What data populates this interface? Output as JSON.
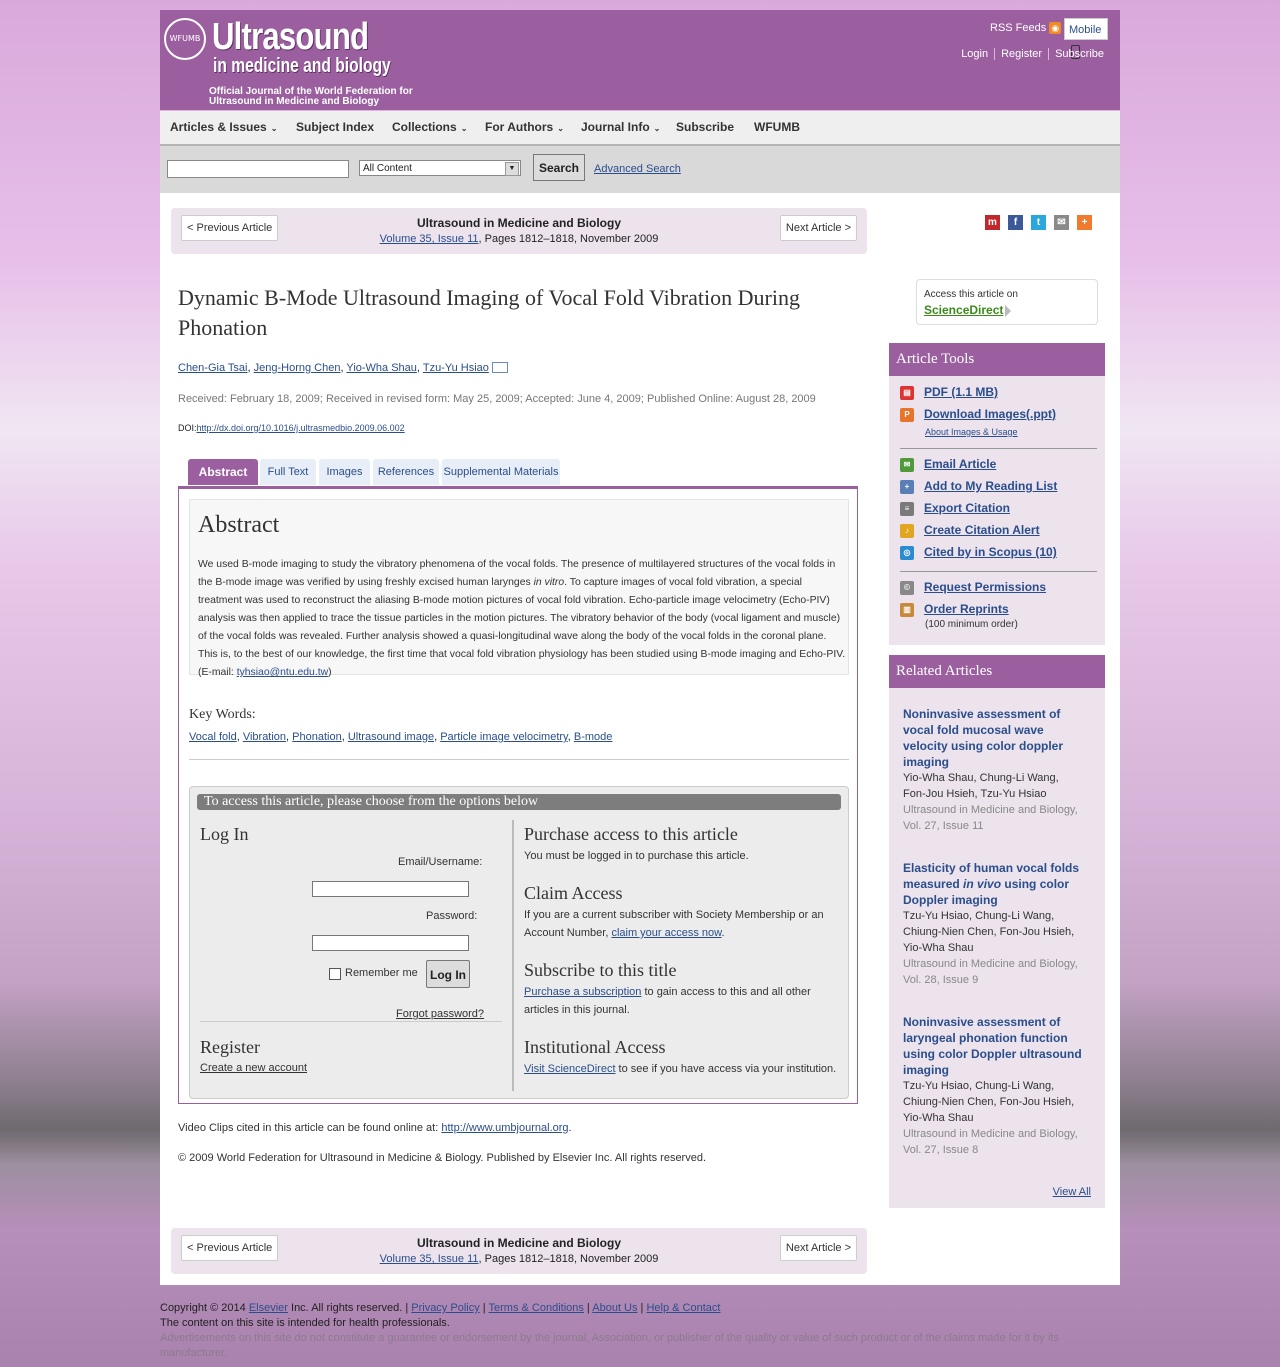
{
  "header": {
    "logo_seal": "WFUMB",
    "logo_title": "Ultrasound",
    "logo_subtitle": "in medicine and biology",
    "logo_desc": "Official Journal of the World Federation for Ultrasound in Medicine and Biology",
    "rss": "RSS Feeds",
    "mobile": "Mobile",
    "login": "Login",
    "register": "Register",
    "subscribe": "Subscribe"
  },
  "nav": {
    "items": [
      "Articles & Issues",
      "Subject Index",
      "Collections",
      "For Authors",
      "Journal Info",
      "Subscribe",
      "WFUMB"
    ]
  },
  "search": {
    "select_value": "All Content",
    "button": "Search",
    "advanced": "Advanced Search"
  },
  "article_nav": {
    "prev": "< Previous Article",
    "next": "Next Article >",
    "journal": "Ultrasound in Medicine and Biology",
    "volume_link": "Volume 35, Issue 11",
    "pages": ", Pages 1812–1818, November 2009"
  },
  "article": {
    "title": "Dynamic B-Mode Ultrasound Imaging of Vocal Fold Vibration During Phonation",
    "authors": [
      "Chen-Gia Tsai",
      "Jeng-Horng Chen",
      "Yio-Wha Shau",
      "Tzu-Yu Hsiao"
    ],
    "dates": "Received: February 18, 2009; Received in revised form: May 25, 2009; Accepted: June 4, 2009; Published Online: August 28, 2009",
    "doi_label": "DOI:",
    "doi": "http://dx.doi.org/10.1016/j.ultrasmedbio.2009.06.002"
  },
  "tabs": [
    "Abstract",
    "Full Text",
    "Images",
    "References",
    "Supplemental Materials"
  ],
  "abstract": {
    "heading": "Abstract",
    "text_1": "We used B-mode imaging to study the vibratory phenomena of the vocal folds. The presence of multilayered structures of the vocal folds in the B-mode image was verified by using freshly excised human larynges ",
    "text_italic": "in vitro",
    "text_2": ". To capture images of vocal fold vibration, a special treatment was used to reconstruct the aliasing B-mode motion pictures of vocal fold vibration. Echo-particle image velocimetry (Echo-PIV) analysis was then applied to trace the tissue particles in the motion pictures. The vibratory behavior of the body (vocal ligament and muscle) of the vocal folds was revealed. Further analysis showed a quasi-longitudinal wave along the body of the vocal folds in the coronal plane. This is, to the best of our knowledge, the first time that vocal fold vibration physiology has been studied using B-mode imaging and Echo-PIV. (E-mail: ",
    "email": "tyhsiao@ntu.edu.tw",
    "text_3": ")"
  },
  "keywords": {
    "heading": "Key Words:",
    "items": [
      "Vocal fold",
      "Vibration",
      "Phonation",
      "Ultrasound image",
      "Particle image velocimetry",
      "B-mode"
    ]
  },
  "access": {
    "bar": "To access this article, please choose from the options below",
    "login_heading": "Log In",
    "email_label": "Email/Username:",
    "password_label": "Password:",
    "remember": "Remember me",
    "login_button": "Log In",
    "forgot": "Forgot password?",
    "register_heading": "Register",
    "create_account": "Create a new account",
    "purchase_heading": "Purchase access to this article",
    "purchase_text": "You must be logged in to purchase this article.",
    "claim_heading": "Claim Access",
    "claim_text": "If you are a current subscriber with Society Membership or an Account Number, ",
    "claim_link": "claim your access now",
    "claim_end": ".",
    "subscribe_heading": "Subscribe to this title",
    "subscribe_link": "Purchase a subscription",
    "subscribe_text": " to gain access to this and all other articles in this journal.",
    "inst_heading": "Institutional Access",
    "inst_link": "Visit ScienceDirect",
    "inst_text": " to see if you have access via your institution."
  },
  "bottom": {
    "video_text": "Video Clips cited in this article can be found online at: ",
    "video_link": "http://www.umbjournal.org",
    "video_end": ".",
    "copyright": "© 2009 World Federation for Ultrasound in Medicine & Biology. Published by Elsevier Inc. All rights reserved."
  },
  "sidebar": {
    "sd_line1": "Access this article on",
    "sd_line2": "ScienceDirect",
    "tools_heading": "Article Tools",
    "tools": [
      "PDF (1.1 MB)",
      "Download Images(.ppt)",
      "Email Article",
      "Add to My Reading List",
      "Export Citation",
      "Create Citation Alert",
      "Cited by in Scopus (10)",
      "Request Permissions",
      "Order Reprints"
    ],
    "about_images": "About Images & Usage",
    "reprints_note": "(100 minimum order)",
    "related_heading": "Related Articles",
    "related": [
      {
        "title": "Noninvasive assessment of vocal fold mucosal wave velocity using color doppler imaging",
        "authors": "Yio-Wha Shau, Chung-Li Wang, Fon-Jou Hsieh, Tzu-Yu Hsiao",
        "journal": "Ultrasound in Medicine and Biology, Vol. 27, Issue 11"
      },
      {
        "title_1": "Elasticity of human vocal folds measured ",
        "title_italic": "in vivo",
        "title_2": " using color Doppler imaging",
        "authors": "Tzu-Yu Hsiao, Chung-Li Wang, Chiung-Nien Chen, Fon-Jou Hsieh, Yio-Wha Shau",
        "journal": "Ultrasound in Medicine and Biology, Vol. 28, Issue 9"
      },
      {
        "title": "Noninvasive assessment of laryngeal phonation function using color Doppler ultrasound imaging",
        "authors": "Tzu-Yu Hsiao, Chung-Li Wang, Chiung-Nien Chen, Fon-Jou Hsieh, Yio-Wha Shau",
        "journal": "Ultrasound in Medicine and Biology, Vol. 27, Issue 8"
      }
    ],
    "view_all": "View All"
  },
  "footer": {
    "copyright_prefix": "Copyright © 2014 ",
    "elsevier": "Elsevier",
    "copyright_suffix": " Inc. All rights reserved. | ",
    "privacy": "Privacy Policy",
    "terms": "Terms & Conditions",
    "about": "About Us",
    "help": "Help & Contact",
    "sep": " | ",
    "line2": "The content on this site is intended for health professionals.",
    "line3": "Advertisements on this site do not constitute a guarantee or endorsement by the journal, Association, or publisher of the quality or value of such product or of the claims made for it by its manufacturer."
  }
}
